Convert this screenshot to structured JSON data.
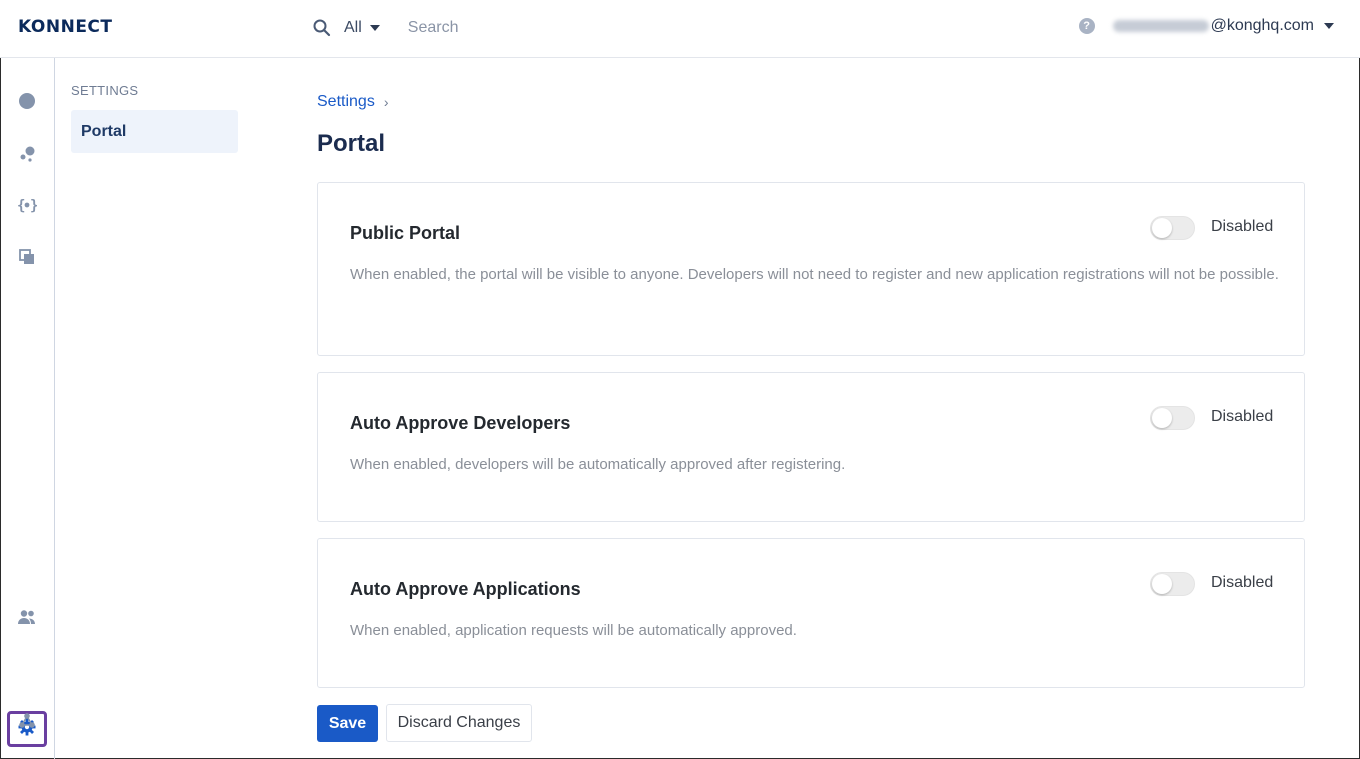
{
  "header": {
    "logo_text": "KONNECT",
    "search_scope": "All",
    "search_placeholder": "Search",
    "user_email_visible": "@konghq.com",
    "help_icon": "?"
  },
  "rail": {
    "icons": [
      "overview-icon",
      "services-icon",
      "api-icon",
      "documents-icon",
      "teams-icon",
      "settings-icon",
      "plugins-icon"
    ],
    "active": "settings-icon",
    "active_highlight_color": "#6a3fa0"
  },
  "subnav": {
    "heading": "SETTINGS",
    "items": [
      {
        "label": "Portal",
        "active": true
      }
    ]
  },
  "breadcrumb": {
    "items": [
      {
        "label": "Settings"
      }
    ],
    "separator": "›"
  },
  "page": {
    "title": "Portal"
  },
  "cards": [
    {
      "title": "Public Portal",
      "description": "When enabled, the portal will be visible to anyone. Developers will not need to register and new application registrations will not be possible.",
      "toggle_state": "Disabled",
      "enabled": false
    },
    {
      "title": "Auto Approve Developers",
      "description": "When enabled, developers will be automatically approved after registering.",
      "toggle_state": "Disabled",
      "enabled": false
    },
    {
      "title": "Auto Approve Applications",
      "description": "When enabled, application requests will be automatically approved.",
      "toggle_state": "Disabled",
      "enabled": false
    }
  ],
  "actions": {
    "save_label": "Save",
    "discard_label": "Discard Changes"
  },
  "colors": {
    "primary": "#1a5ac7",
    "title": "#1b2c4f",
    "rail_icon": "#8493ab"
  }
}
